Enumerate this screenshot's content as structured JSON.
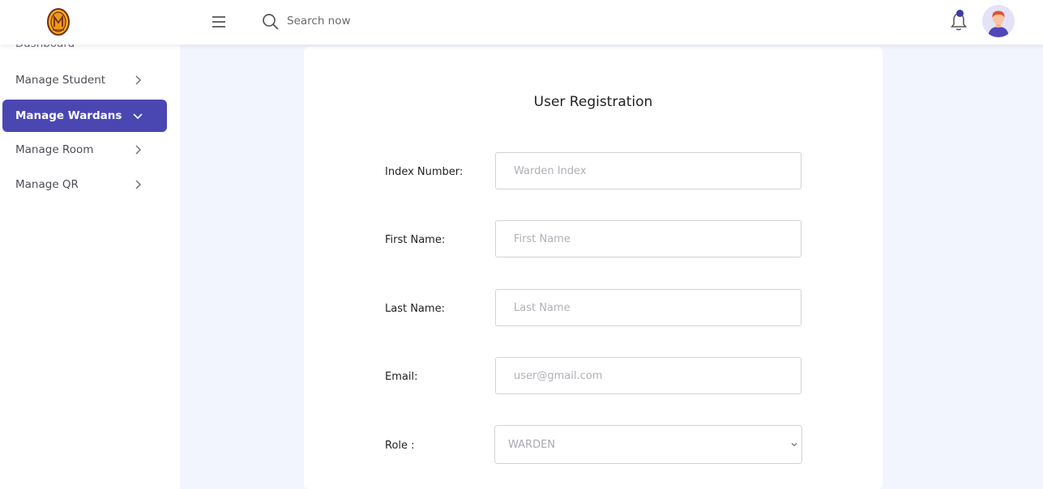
{
  "header": {
    "search": {
      "placeholder": "Search now",
      "value": ""
    },
    "notification_indicator": true
  },
  "sidebar": {
    "partial_item_label": "Dashboard",
    "items": [
      {
        "label": "Manage Student",
        "icon": "chevron-right-icon",
        "active": false
      },
      {
        "label": "Manage Wardans",
        "icon": "chevron-down-icon",
        "active": true
      },
      {
        "label": "Manage Room",
        "icon": "chevron-right-icon",
        "active": false
      },
      {
        "label": "Manage QR",
        "icon": "chevron-right-icon",
        "active": false
      }
    ]
  },
  "form": {
    "title": "User Registration",
    "fields": {
      "index_number": {
        "label": "Index Number:",
        "placeholder": "Warden Index",
        "value": ""
      },
      "first_name": {
        "label": "First Name:",
        "placeholder": "First Name",
        "value": ""
      },
      "last_name": {
        "label": "Last Name:",
        "placeholder": "Last Name",
        "value": ""
      },
      "email": {
        "label": "Email:",
        "placeholder": "user@gmail.com",
        "value": ""
      },
      "role": {
        "label": "Role :",
        "selected": "WARDEN"
      }
    }
  },
  "colors": {
    "accent": "#4a47b3",
    "page_background": "#f3f5fe",
    "bell_dot": "#3e3aa6"
  }
}
